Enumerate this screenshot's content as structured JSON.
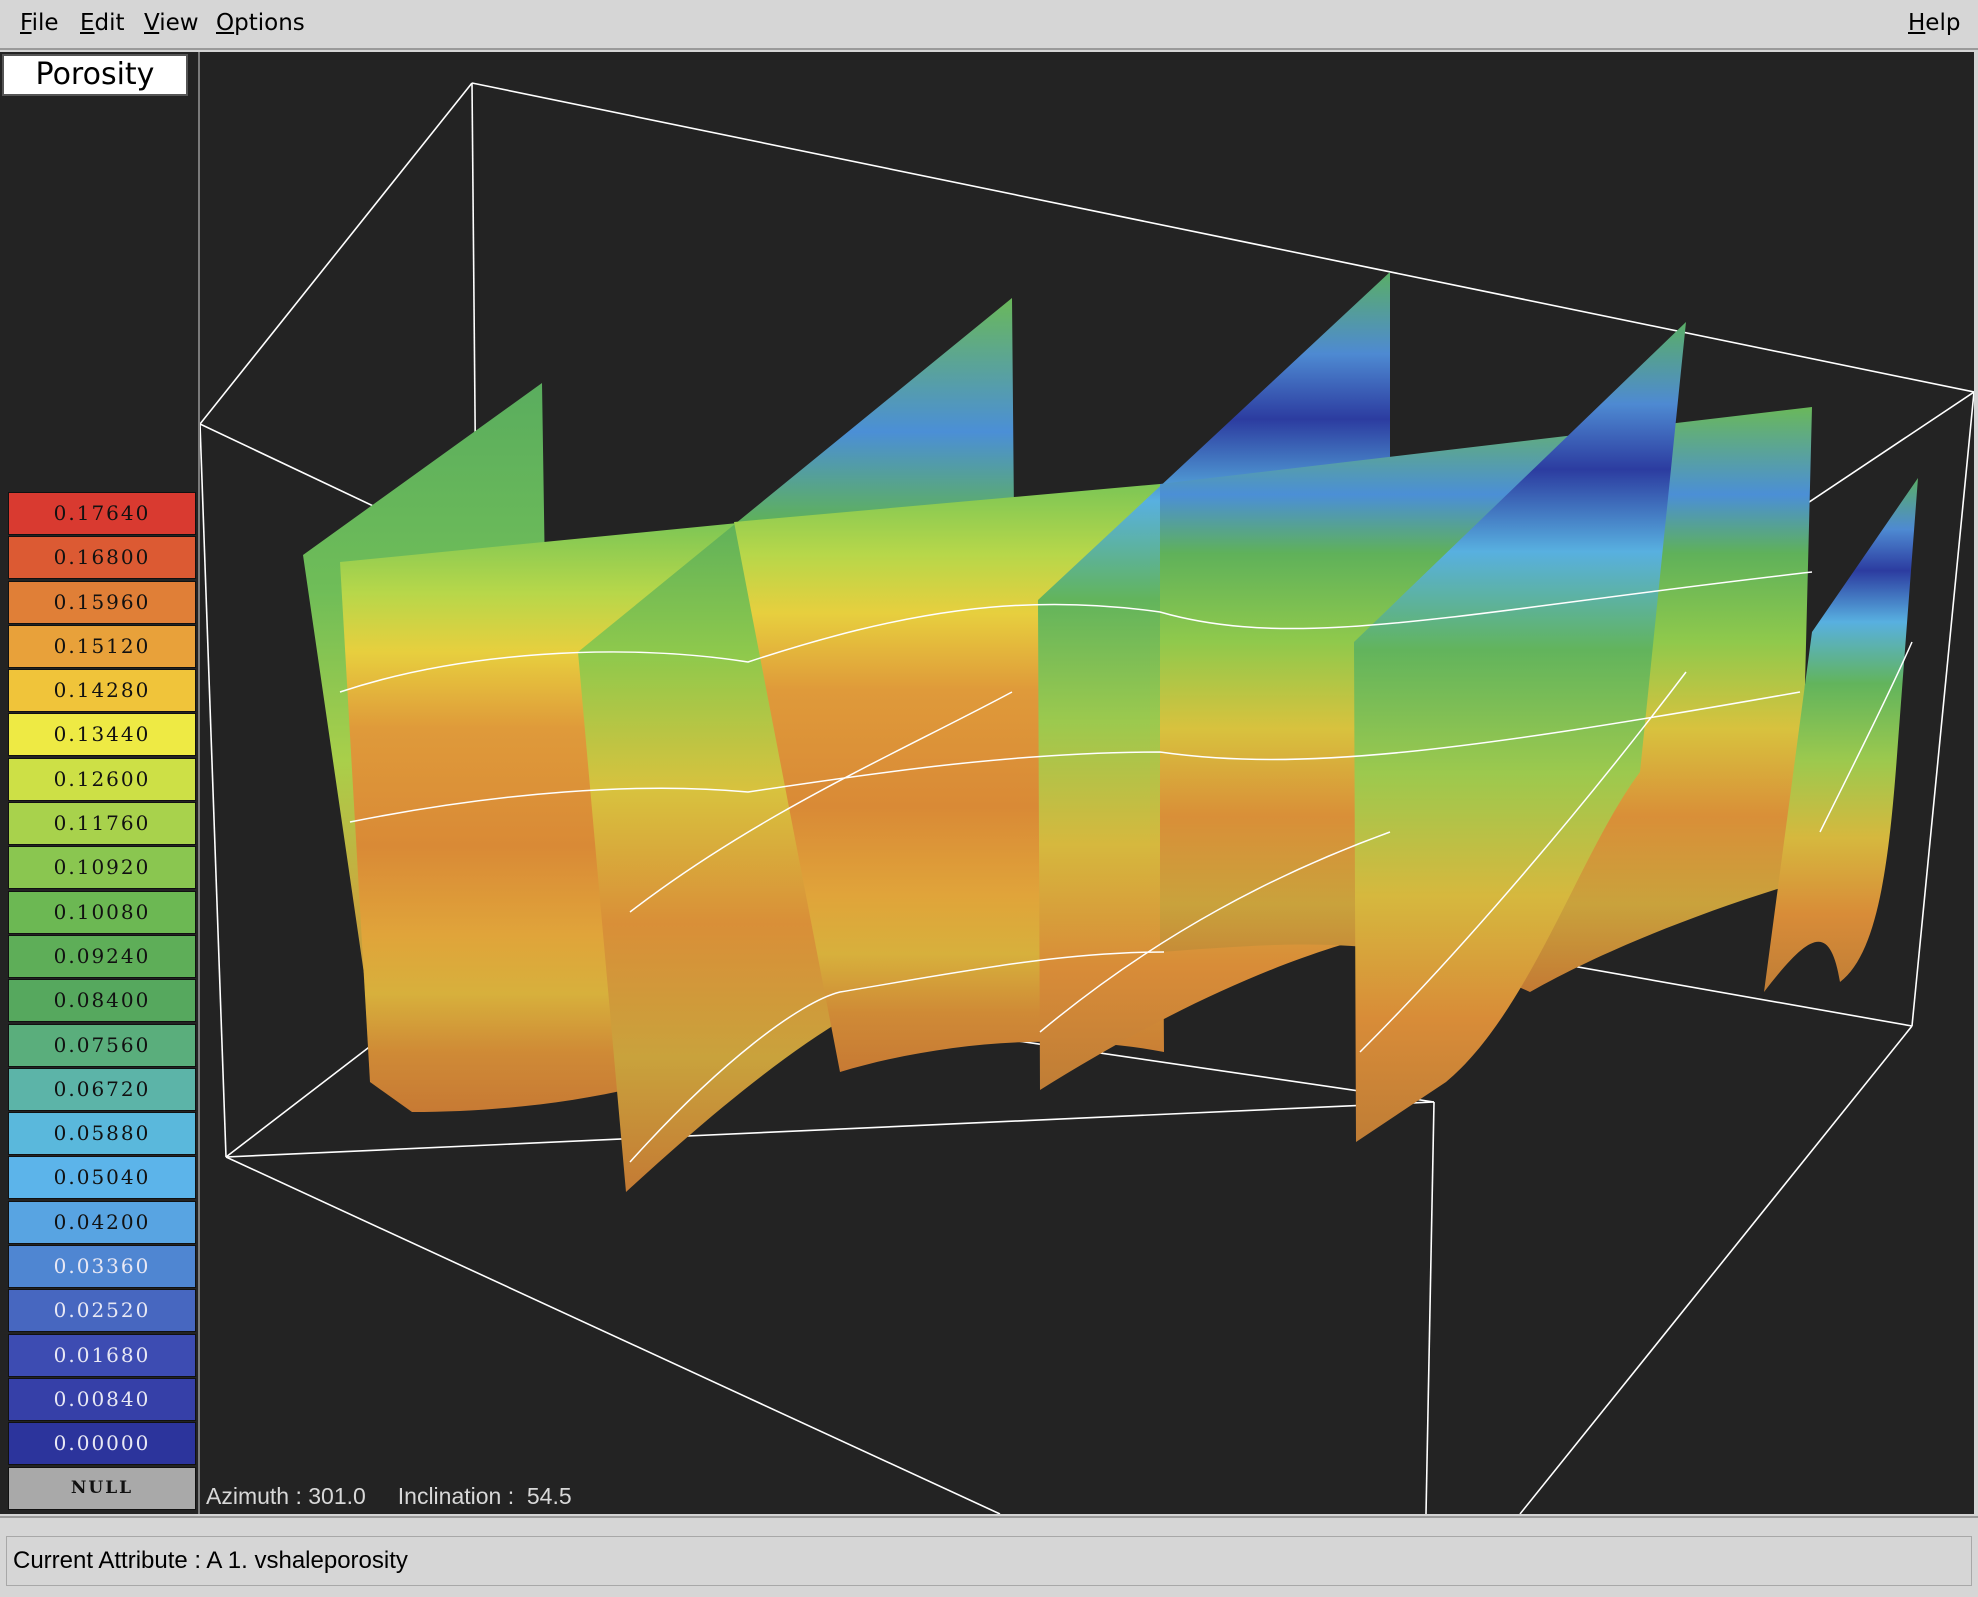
{
  "menu": {
    "file": "File",
    "edit": "Edit",
    "view": "View",
    "options": "Options",
    "help": "Help"
  },
  "legend": {
    "title": "Porosity",
    "bins": [
      {
        "label": "0.17640",
        "color": "#d93a30"
      },
      {
        "label": "0.16800",
        "color": "#dc5a33"
      },
      {
        "label": "0.15960",
        "color": "#e07f37"
      },
      {
        "label": "0.15120",
        "color": "#e8a13a"
      },
      {
        "label": "0.14280",
        "color": "#f0c43a"
      },
      {
        "label": "0.13440",
        "color": "#eeea44"
      },
      {
        "label": "0.12600",
        "color": "#cde046"
      },
      {
        "label": "0.11760",
        "color": "#a8d24c"
      },
      {
        "label": "0.10920",
        "color": "#8ac650"
      },
      {
        "label": "0.10080",
        "color": "#6cb853"
      },
      {
        "label": "0.09240",
        "color": "#5eae58"
      },
      {
        "label": "0.08400",
        "color": "#56a85e"
      },
      {
        "label": "0.07560",
        "color": "#5aae7c"
      },
      {
        "label": "0.06720",
        "color": "#5cb4a8"
      },
      {
        "label": "0.05880",
        "color": "#5ab8dc"
      },
      {
        "label": "0.05040",
        "color": "#5cb4ea"
      },
      {
        "label": "0.04200",
        "color": "#58a4e2"
      },
      {
        "label": "0.03360",
        "color": "#4f86d2"
      },
      {
        "label": "0.02520",
        "color": "#4767c0"
      },
      {
        "label": "0.01680",
        "color": "#3d4cb2"
      },
      {
        "label": "0.00840",
        "color": "#3640a8"
      },
      {
        "label": "0.00000",
        "color": "#2c349c"
      },
      {
        "label": "NULL",
        "color": "#a9a9a9"
      }
    ]
  },
  "viewer": {
    "azimuth_label": "Azimuth : 301.0",
    "inclination_label": "Inclination :  54.5"
  },
  "status": {
    "text": "Current Attribute : A  1. vshaleporosity"
  },
  "colors": {
    "viewport_bg": "#232323",
    "bounding_box": "#ffffff",
    "horizon_line": "#ffffff"
  }
}
